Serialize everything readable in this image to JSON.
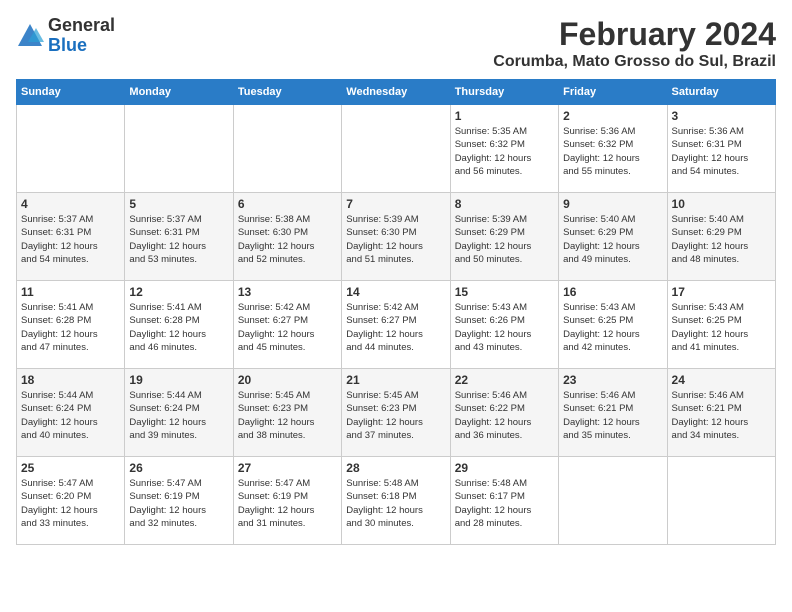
{
  "header": {
    "logo_line1": "General",
    "logo_line2": "Blue",
    "month": "February 2024",
    "location": "Corumba, Mato Grosso do Sul, Brazil"
  },
  "days_of_week": [
    "Sunday",
    "Monday",
    "Tuesday",
    "Wednesday",
    "Thursday",
    "Friday",
    "Saturday"
  ],
  "weeks": [
    [
      {
        "num": "",
        "info": ""
      },
      {
        "num": "",
        "info": ""
      },
      {
        "num": "",
        "info": ""
      },
      {
        "num": "",
        "info": ""
      },
      {
        "num": "1",
        "info": "Sunrise: 5:35 AM\nSunset: 6:32 PM\nDaylight: 12 hours\nand 56 minutes."
      },
      {
        "num": "2",
        "info": "Sunrise: 5:36 AM\nSunset: 6:32 PM\nDaylight: 12 hours\nand 55 minutes."
      },
      {
        "num": "3",
        "info": "Sunrise: 5:36 AM\nSunset: 6:31 PM\nDaylight: 12 hours\nand 54 minutes."
      }
    ],
    [
      {
        "num": "4",
        "info": "Sunrise: 5:37 AM\nSunset: 6:31 PM\nDaylight: 12 hours\nand 54 minutes."
      },
      {
        "num": "5",
        "info": "Sunrise: 5:37 AM\nSunset: 6:31 PM\nDaylight: 12 hours\nand 53 minutes."
      },
      {
        "num": "6",
        "info": "Sunrise: 5:38 AM\nSunset: 6:30 PM\nDaylight: 12 hours\nand 52 minutes."
      },
      {
        "num": "7",
        "info": "Sunrise: 5:39 AM\nSunset: 6:30 PM\nDaylight: 12 hours\nand 51 minutes."
      },
      {
        "num": "8",
        "info": "Sunrise: 5:39 AM\nSunset: 6:29 PM\nDaylight: 12 hours\nand 50 minutes."
      },
      {
        "num": "9",
        "info": "Sunrise: 5:40 AM\nSunset: 6:29 PM\nDaylight: 12 hours\nand 49 minutes."
      },
      {
        "num": "10",
        "info": "Sunrise: 5:40 AM\nSunset: 6:29 PM\nDaylight: 12 hours\nand 48 minutes."
      }
    ],
    [
      {
        "num": "11",
        "info": "Sunrise: 5:41 AM\nSunset: 6:28 PM\nDaylight: 12 hours\nand 47 minutes."
      },
      {
        "num": "12",
        "info": "Sunrise: 5:41 AM\nSunset: 6:28 PM\nDaylight: 12 hours\nand 46 minutes."
      },
      {
        "num": "13",
        "info": "Sunrise: 5:42 AM\nSunset: 6:27 PM\nDaylight: 12 hours\nand 45 minutes."
      },
      {
        "num": "14",
        "info": "Sunrise: 5:42 AM\nSunset: 6:27 PM\nDaylight: 12 hours\nand 44 minutes."
      },
      {
        "num": "15",
        "info": "Sunrise: 5:43 AM\nSunset: 6:26 PM\nDaylight: 12 hours\nand 43 minutes."
      },
      {
        "num": "16",
        "info": "Sunrise: 5:43 AM\nSunset: 6:25 PM\nDaylight: 12 hours\nand 42 minutes."
      },
      {
        "num": "17",
        "info": "Sunrise: 5:43 AM\nSunset: 6:25 PM\nDaylight: 12 hours\nand 41 minutes."
      }
    ],
    [
      {
        "num": "18",
        "info": "Sunrise: 5:44 AM\nSunset: 6:24 PM\nDaylight: 12 hours\nand 40 minutes."
      },
      {
        "num": "19",
        "info": "Sunrise: 5:44 AM\nSunset: 6:24 PM\nDaylight: 12 hours\nand 39 minutes."
      },
      {
        "num": "20",
        "info": "Sunrise: 5:45 AM\nSunset: 6:23 PM\nDaylight: 12 hours\nand 38 minutes."
      },
      {
        "num": "21",
        "info": "Sunrise: 5:45 AM\nSunset: 6:23 PM\nDaylight: 12 hours\nand 37 minutes."
      },
      {
        "num": "22",
        "info": "Sunrise: 5:46 AM\nSunset: 6:22 PM\nDaylight: 12 hours\nand 36 minutes."
      },
      {
        "num": "23",
        "info": "Sunrise: 5:46 AM\nSunset: 6:21 PM\nDaylight: 12 hours\nand 35 minutes."
      },
      {
        "num": "24",
        "info": "Sunrise: 5:46 AM\nSunset: 6:21 PM\nDaylight: 12 hours\nand 34 minutes."
      }
    ],
    [
      {
        "num": "25",
        "info": "Sunrise: 5:47 AM\nSunset: 6:20 PM\nDaylight: 12 hours\nand 33 minutes."
      },
      {
        "num": "26",
        "info": "Sunrise: 5:47 AM\nSunset: 6:19 PM\nDaylight: 12 hours\nand 32 minutes."
      },
      {
        "num": "27",
        "info": "Sunrise: 5:47 AM\nSunset: 6:19 PM\nDaylight: 12 hours\nand 31 minutes."
      },
      {
        "num": "28",
        "info": "Sunrise: 5:48 AM\nSunset: 6:18 PM\nDaylight: 12 hours\nand 30 minutes."
      },
      {
        "num": "29",
        "info": "Sunrise: 5:48 AM\nSunset: 6:17 PM\nDaylight: 12 hours\nand 28 minutes."
      },
      {
        "num": "",
        "info": ""
      },
      {
        "num": "",
        "info": ""
      }
    ]
  ]
}
